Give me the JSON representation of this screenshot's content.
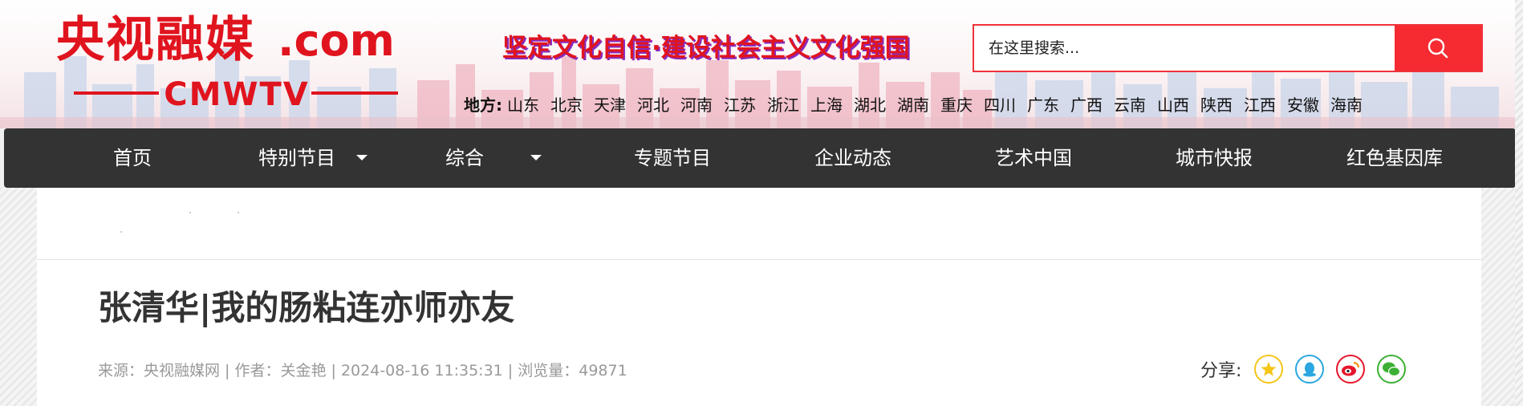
{
  "header": {
    "logo": {
      "cn": "央视融媒",
      "domain": ".com",
      "en": "CMWTV"
    },
    "slogan": "坚定文化自信·建设社会主义文化强国",
    "search": {
      "placeholder": "在这里搜索...",
      "button_icon": "search-icon"
    },
    "regions": {
      "label": "地方:",
      "items": [
        "山东",
        "北京",
        "天津",
        "河北",
        "河南",
        "江苏",
        "浙江",
        "上海",
        "湖北",
        "湖南",
        "重庆",
        "四川",
        "广东",
        "广西",
        "云南",
        "山西",
        "陕西",
        "江西",
        "安徽",
        "海南"
      ]
    }
  },
  "nav": {
    "items": [
      {
        "label": "首页",
        "has_dropdown": false
      },
      {
        "label": "特别节目",
        "has_dropdown": true
      },
      {
        "label": "综合",
        "has_dropdown": true
      },
      {
        "label": "专题节目",
        "has_dropdown": false
      },
      {
        "label": "企业动态",
        "has_dropdown": false
      },
      {
        "label": "艺术中国",
        "has_dropdown": false
      },
      {
        "label": "城市快报",
        "has_dropdown": false
      },
      {
        "label": "红色基因库",
        "has_dropdown": false
      }
    ]
  },
  "article": {
    "title": "张清华|我的肠粘连亦师亦友",
    "meta": "来源：央视融媒网 | 作者：关金艳 | 2024-08-16 11:35:31 | 浏览量：49871"
  },
  "share": {
    "label": "分享:",
    "icons": [
      "qzone-star-icon",
      "qq-icon",
      "weibo-icon",
      "wechat-icon"
    ]
  },
  "colors": {
    "brand_red": "#e0141e",
    "search_red": "#f52b31",
    "nav_bg": "#333333",
    "meta_gray": "#999999"
  }
}
